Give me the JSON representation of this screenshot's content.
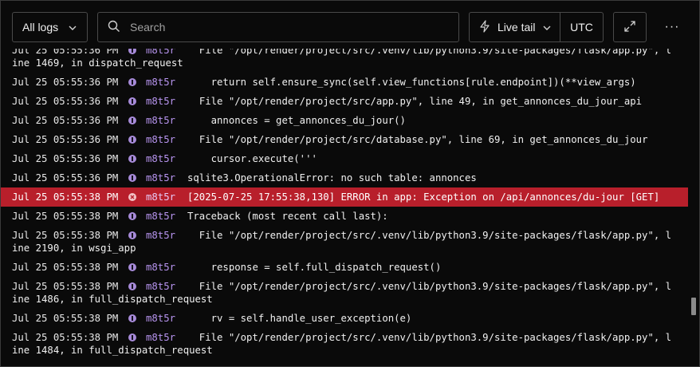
{
  "toolbar": {
    "logs_filter_label": "All logs",
    "search_placeholder": "Search",
    "live_tail_label": "Live tail",
    "timezone_label": "UTC",
    "more_label": "···"
  },
  "logs": [
    {
      "ts": "Jul 25 05:55:36 PM",
      "level": "info",
      "instance": "m8t5r",
      "text": "  File \"/opt/render/project/src/.venv/lib/python3.9/site-packages/flask/app.py\", line 1469, in dispatch_request",
      "partial": true
    },
    {
      "ts": "Jul 25 05:55:36 PM",
      "level": "info",
      "instance": "m8t5r",
      "text": "    return self.ensure_sync(self.view_functions[rule.endpoint])(**view_args)"
    },
    {
      "ts": "Jul 25 05:55:36 PM",
      "level": "info",
      "instance": "m8t5r",
      "text": "  File \"/opt/render/project/src/app.py\", line 49, in get_annonces_du_jour_api"
    },
    {
      "ts": "Jul 25 05:55:36 PM",
      "level": "info",
      "instance": "m8t5r",
      "text": "    annonces = get_annonces_du_jour()"
    },
    {
      "ts": "Jul 25 05:55:36 PM",
      "level": "info",
      "instance": "m8t5r",
      "text": "  File \"/opt/render/project/src/database.py\", line 69, in get_annonces_du_jour"
    },
    {
      "ts": "Jul 25 05:55:36 PM",
      "level": "info",
      "instance": "m8t5r",
      "text": "    cursor.execute('''"
    },
    {
      "ts": "Jul 25 05:55:36 PM",
      "level": "info",
      "instance": "m8t5r",
      "text": "sqlite3.OperationalError: no such table: annonces"
    },
    {
      "ts": "Jul 25 05:55:38 PM",
      "level": "error",
      "instance": "m8t5r",
      "text": "[2025-07-25 17:55:38,130] ERROR in app: Exception on /api/annonces/du-jour [GET]"
    },
    {
      "ts": "Jul 25 05:55:38 PM",
      "level": "info",
      "instance": "m8t5r",
      "text": "Traceback (most recent call last):"
    },
    {
      "ts": "Jul 25 05:55:38 PM",
      "level": "info",
      "instance": "m8t5r",
      "text": "  File \"/opt/render/project/src/.venv/lib/python3.9/site-packages/flask/app.py\", line 2190, in wsgi_app"
    },
    {
      "ts": "Jul 25 05:55:38 PM",
      "level": "info",
      "instance": "m8t5r",
      "text": "    response = self.full_dispatch_request()"
    },
    {
      "ts": "Jul 25 05:55:38 PM",
      "level": "info",
      "instance": "m8t5r",
      "text": "  File \"/opt/render/project/src/.venv/lib/python3.9/site-packages/flask/app.py\", line 1486, in full_dispatch_request"
    },
    {
      "ts": "Jul 25 05:55:38 PM",
      "level": "info",
      "instance": "m8t5r",
      "text": "    rv = self.handle_user_exception(e)"
    },
    {
      "ts": "Jul 25 05:55:38 PM",
      "level": "info",
      "instance": "m8t5r",
      "text": "  File \"/opt/render/project/src/.venv/lib/python3.9/site-packages/flask/app.py\", line 1484, in full_dispatch_request"
    }
  ]
}
